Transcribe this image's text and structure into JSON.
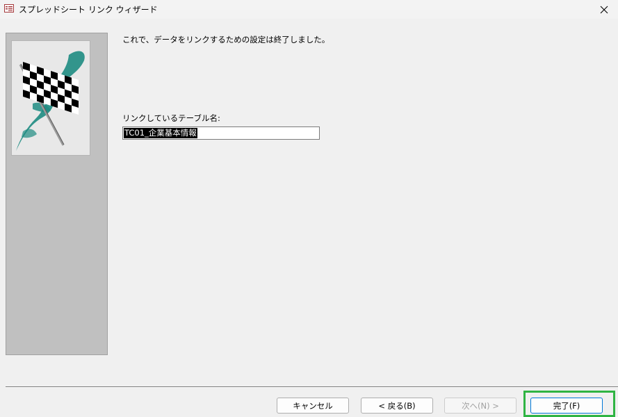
{
  "window": {
    "title": "スプレッドシート リンク ウィザード",
    "close_glyph": "✕"
  },
  "main": {
    "message": "これで、データをリンクするための設定は終了しました。",
    "table_name_label": "リンクしているテーブル名:",
    "table_name_value": "TC01_企業基本情報"
  },
  "footer": {
    "cancel_label": "キャンセル",
    "back_label": "< 戻る(B)",
    "next_label": "次へ(N) >",
    "finish_label": "完了(F)"
  },
  "colors": {
    "flag_teal": "#1e8c82",
    "highlight": "#2fb443",
    "selection": "#000000"
  }
}
